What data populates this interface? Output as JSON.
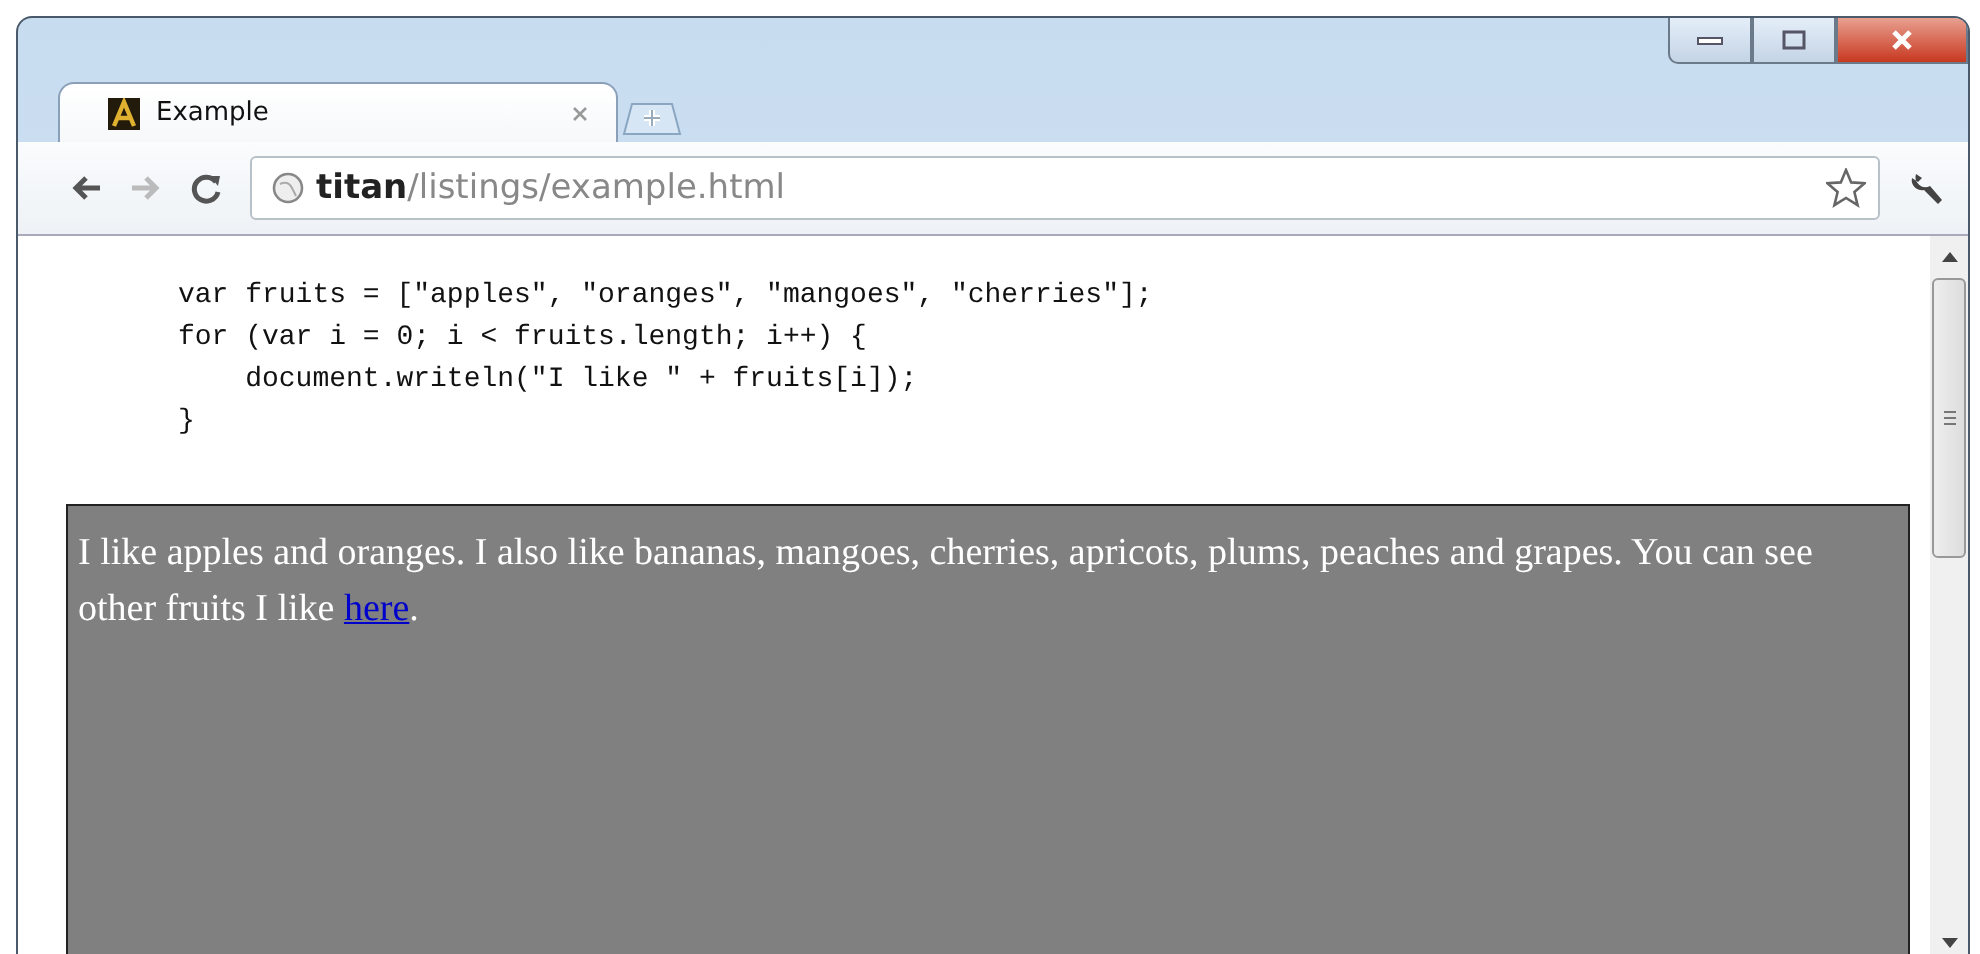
{
  "window": {
    "tab": {
      "title": "Example",
      "selected": true
    },
    "address": {
      "host": "titan",
      "path": "/listings/example.html"
    }
  },
  "page": {
    "code_lines": [
      "var fruits = [\"apples\", \"oranges\", \"mangoes\", \"cherries\"];",
      "for (var i = 0; i < fruits.length; i++) {",
      "    document.writeln(\"I like \" + fruits[i]);",
      "}"
    ],
    "paragraph": {
      "text": "I like apples and oranges. I also like bananas, mangoes, cherries, apricots, plums, peaches and grapes. You can see other fruits I like ",
      "link": "here",
      "end": "."
    }
  }
}
